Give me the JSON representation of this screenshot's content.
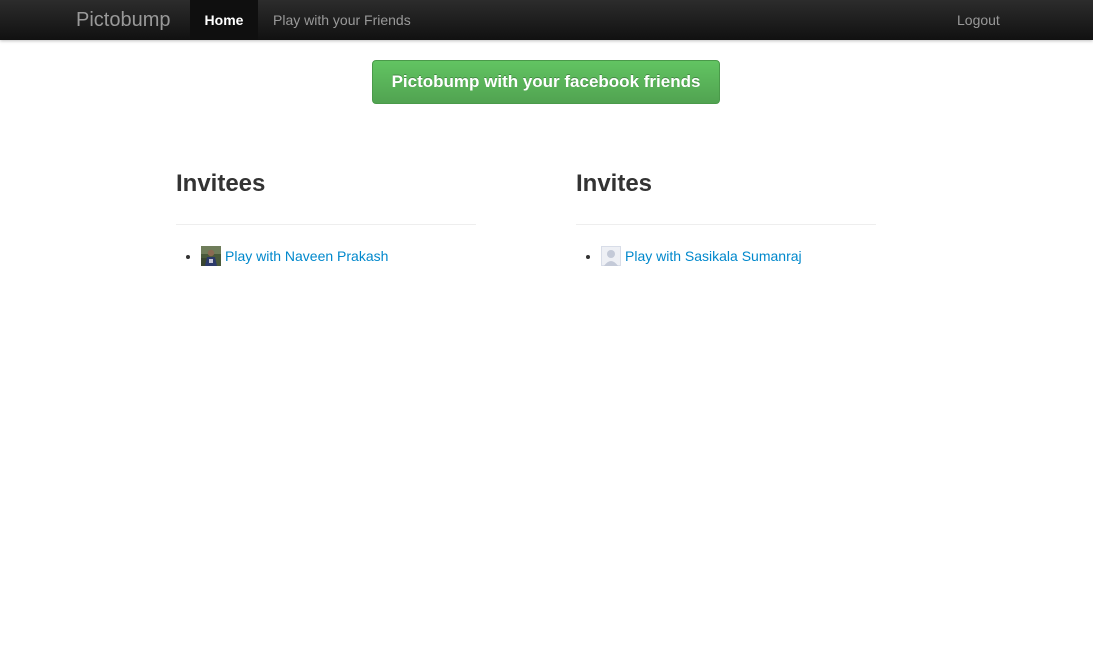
{
  "navbar": {
    "brand": "Pictobump",
    "items": [
      {
        "label": "Home",
        "active": true
      },
      {
        "label": "Play with your Friends",
        "active": false
      }
    ],
    "logout_label": "Logout"
  },
  "main": {
    "cta_label": "Pictobump with your facebook friends",
    "invitees": {
      "title": "Invitees",
      "items": [
        {
          "label": "Play with Naveen Prakash",
          "avatar": "user-photo-icon"
        }
      ]
    },
    "invites": {
      "title": "Invites",
      "items": [
        {
          "label": "Play with Sasikala Sumanraj",
          "avatar": "default-user-icon"
        }
      ]
    }
  },
  "colors": {
    "navbar": "#1b1b1b",
    "button_green": "#5bb75b",
    "link": "#0088cc"
  }
}
